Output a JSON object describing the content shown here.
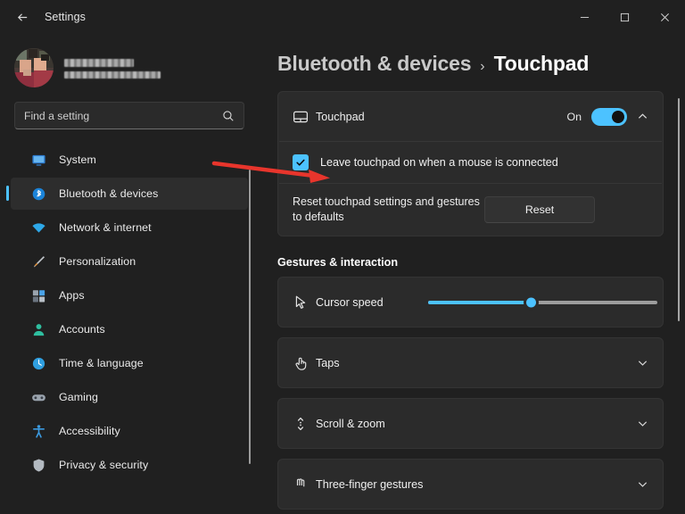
{
  "window": {
    "title": "Settings",
    "back_icon": "back-arrow-icon",
    "minimize_label": "Minimize",
    "maximize_label": "Maximize",
    "close_label": "Close"
  },
  "account": {
    "name_redacted": true,
    "email_redacted": true,
    "avatar_icon": "user-avatar"
  },
  "search": {
    "placeholder": "Find a setting",
    "value": "",
    "icon": "search-icon"
  },
  "sidebar": {
    "items": [
      {
        "label": "System",
        "icon": "display-icon",
        "active": false
      },
      {
        "label": "Bluetooth & devices",
        "icon": "bluetooth-icon",
        "active": true
      },
      {
        "label": "Network & internet",
        "icon": "wifi-icon",
        "active": false
      },
      {
        "label": "Personalization",
        "icon": "paintbrush-icon",
        "active": false
      },
      {
        "label": "Apps",
        "icon": "apps-icon",
        "active": false
      },
      {
        "label": "Accounts",
        "icon": "person-icon",
        "active": false
      },
      {
        "label": "Time & language",
        "icon": "clock-icon",
        "active": false
      },
      {
        "label": "Gaming",
        "icon": "gamepad-icon",
        "active": false
      },
      {
        "label": "Accessibility",
        "icon": "accessibility-icon",
        "active": false
      },
      {
        "label": "Privacy & security",
        "icon": "shield-icon",
        "active": false
      }
    ]
  },
  "breadcrumb": {
    "parent": "Bluetooth & devices",
    "separator": "›",
    "current": "Touchpad"
  },
  "touchpad_card": {
    "label": "Touchpad",
    "icon": "touchpad-icon",
    "toggle_state": "On",
    "toggle_on": true,
    "expand_icon": "chevron-up-icon",
    "checkbox": {
      "label": "Leave touchpad on when a mouse is connected",
      "checked": true
    },
    "reset": {
      "description": "Reset touchpad settings and gestures to defaults",
      "button_label": "Reset"
    }
  },
  "gestures": {
    "section_title": "Gestures & interaction",
    "cursor_speed": {
      "label": "Cursor speed",
      "icon": "cursor-arrow-icon",
      "value_percent": 45
    },
    "rows": [
      {
        "label": "Taps",
        "icon": "tap-hand-icon",
        "expand_icon": "chevron-down-icon"
      },
      {
        "label": "Scroll & zoom",
        "icon": "scroll-updown-icon",
        "expand_icon": "chevron-down-icon"
      },
      {
        "label": "Three-finger gestures",
        "icon": "three-finger-icon",
        "expand_icon": "chevron-down-icon"
      }
    ]
  },
  "annotation": {
    "type": "red-arrow",
    "color": "#e8352c",
    "points_to": "Leave touchpad on when a mouse is connected"
  },
  "colors": {
    "accent": "#4cc2ff",
    "window_bg": "#202020",
    "card_bg": "#2b2b2b",
    "annotation_red": "#e8352c"
  }
}
